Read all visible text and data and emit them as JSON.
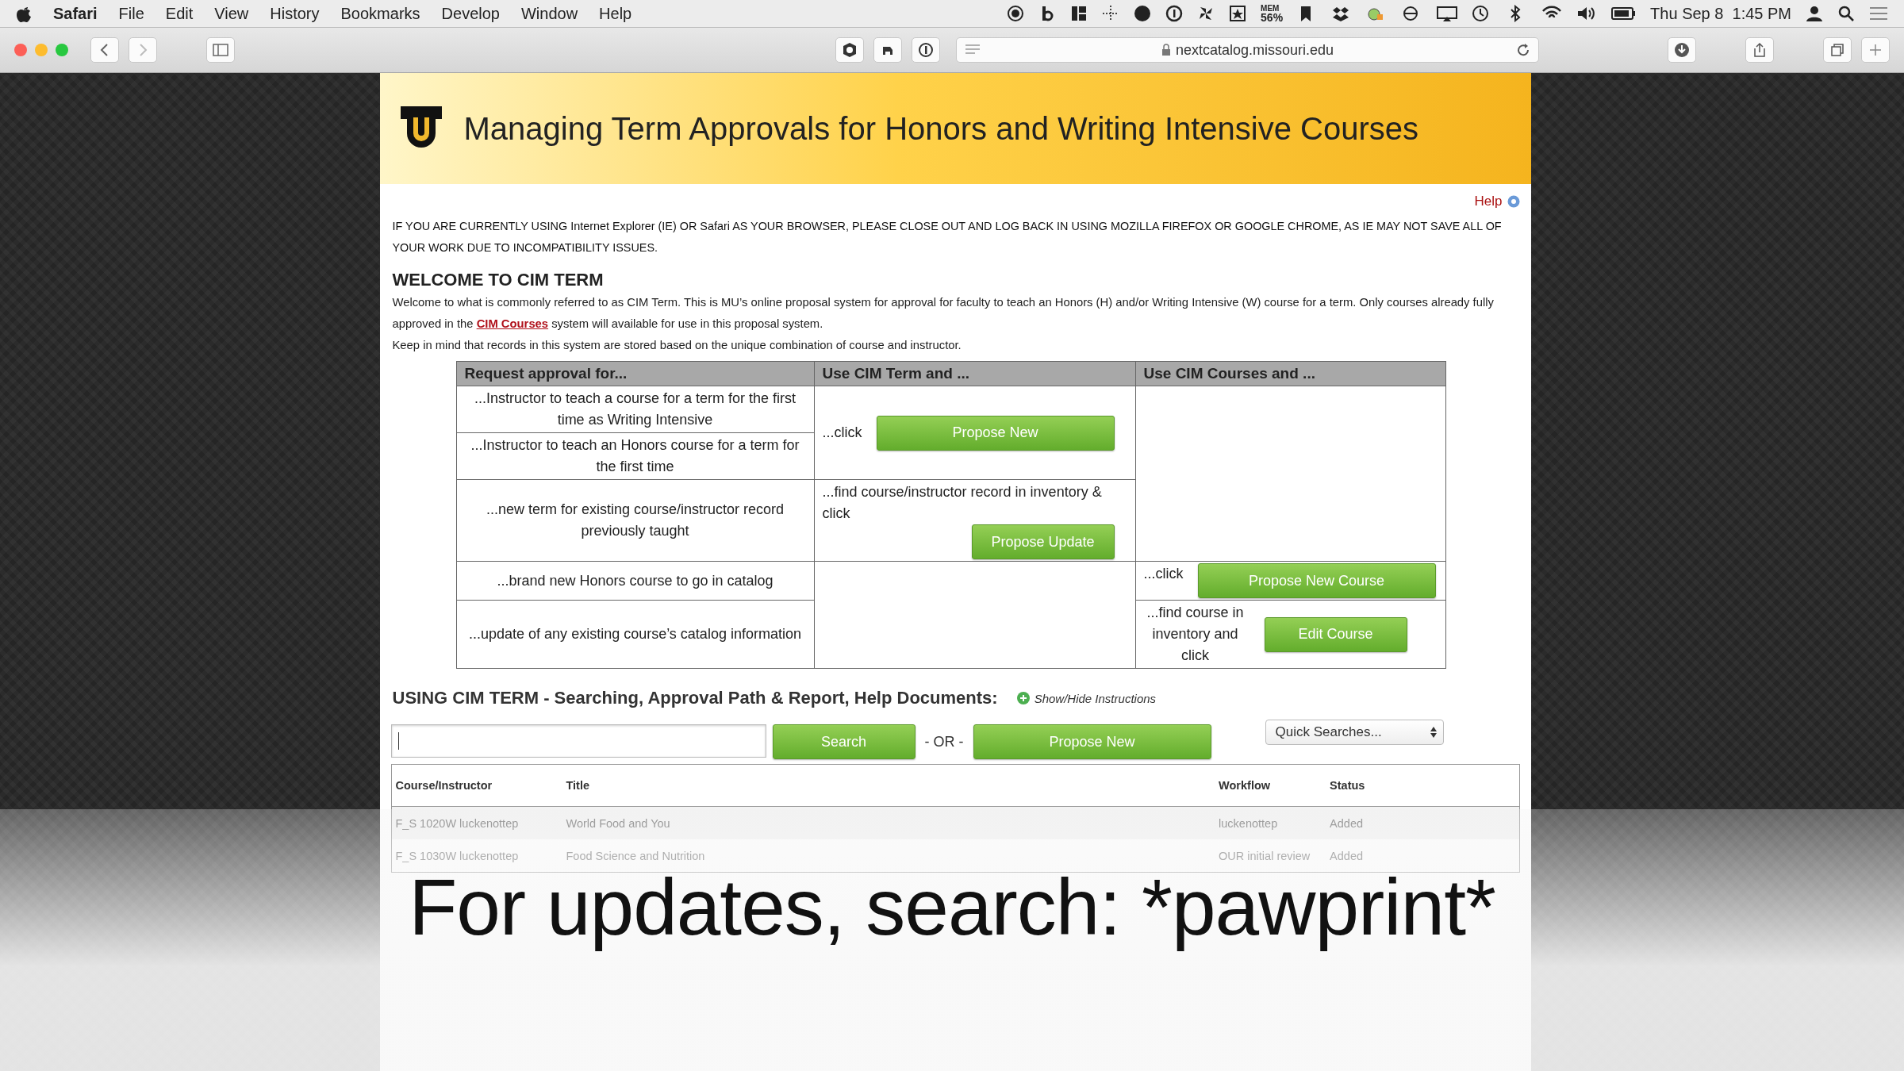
{
  "menu_bar": {
    "app": "Safari",
    "menus": [
      "File",
      "Edit",
      "View",
      "History",
      "Bookmarks",
      "Develop",
      "Window",
      "Help"
    ],
    "memory": {
      "label": "MEM",
      "value": "56%"
    },
    "clock": "Thu Sep 8  1:45 PM"
  },
  "toolbar": {
    "url": "nextcatalog.missouri.edu"
  },
  "header": {
    "title": "Managing Term Approvals for Honors and Writing Intensive Courses"
  },
  "help_link": "Help",
  "notice": "IF YOU ARE CURRENTLY USING Internet Explorer (IE) OR Safari AS YOUR BROWSER, PLEASE CLOSE OUT AND LOG BACK IN USING MOZILLA FIREFOX OR GOOGLE CHROME, AS IE MAY NOT SAVE ALL OF YOUR WORK DUE TO INCOMPATIBILITY ISSUES.",
  "welcome": {
    "heading": "WELCOME TO CIM TERM",
    "text_before": "Welcome to what is commonly referred to as CIM Term. This is MU’s online proposal system for approval for faculty to teach an Honors (H) and/or Writing Intensive (W) course for a term. Only courses already fully approved in the ",
    "link": "CIM Courses",
    "text_after": " system will available for use in this proposal system.",
    "note": "Keep in mind that records in this system are stored based on the unique combination of course and instructor."
  },
  "guide_table": {
    "columns": [
      "Request approval for...",
      "Use CIM Term and  ...",
      "Use CIM Courses and ..."
    ],
    "requests": [
      "...Instructor to teach a course for a term for the first time as Writing Intensive",
      "...Instructor to teach an Honors course for a term for the first time",
      "...new term for existing course/instructor record previously taught",
      "...brand new Honors course to go in catalog",
      "...update of any existing course’s catalog information"
    ],
    "cim_term": [
      {
        "text": "...click",
        "button": "Propose New"
      },
      {
        "text": "...find course/instructor record in inventory & click",
        "button": "Propose Update"
      }
    ],
    "cim_courses": [
      {
        "text": "...click",
        "button": "Propose New Course"
      },
      {
        "text": "...find course in inventory and click",
        "button": "Edit Course"
      }
    ]
  },
  "section": {
    "heading": "USING CIM TERM - Searching, Approval Path & Report, Help Documents:",
    "toggle": "Show/Hide Instructions"
  },
  "search": {
    "button": "Search",
    "separator": "- OR -",
    "propose_button": "Propose New",
    "quick_searches": "Quick Searches..."
  },
  "results": {
    "columns": [
      "Course/Instructor",
      "Title",
      "Workflow",
      "Status"
    ],
    "rows": [
      {
        "course": "F_S 1020W luckenottep",
        "title": "World Food and You",
        "workflow": "luckenottep",
        "status": "Added"
      },
      {
        "course": "F_S 1030W luckenottep",
        "title": "Food Science and Nutrition",
        "workflow": "OUR initial review",
        "status": "Added"
      }
    ]
  },
  "caption": "For updates, search: *pawprint*"
}
